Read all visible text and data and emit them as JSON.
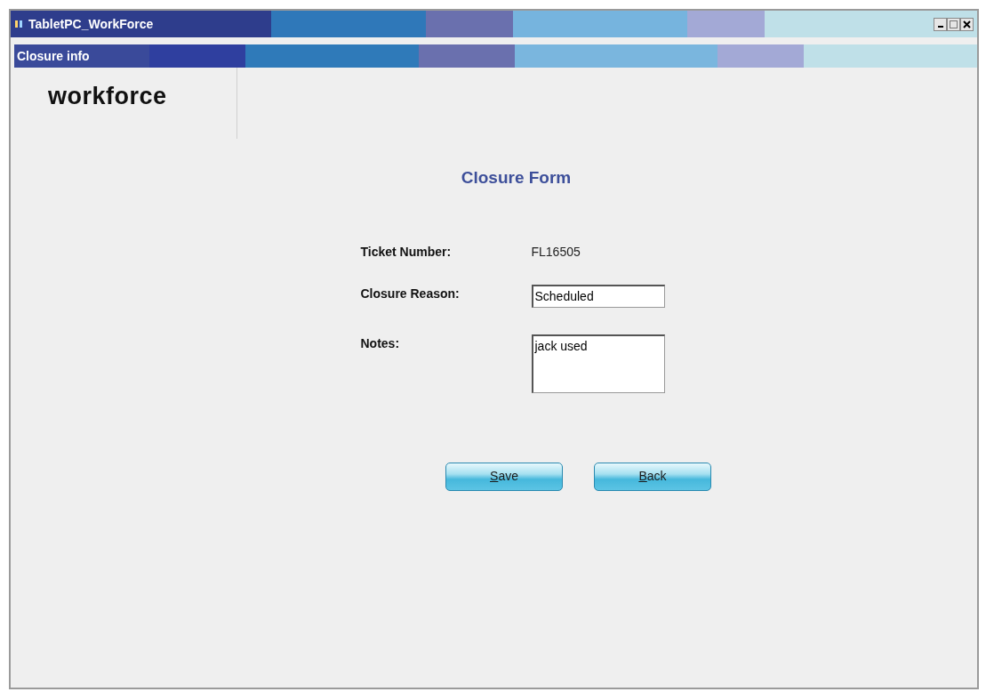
{
  "window": {
    "title": "TabletPC_WorkForce"
  },
  "subtitle_bar": {
    "title": "Closure info"
  },
  "logo": {
    "text": "workforce"
  },
  "form": {
    "title": "Closure Form",
    "fields": [
      {
        "kind": "static",
        "label": "Ticket Number:",
        "value": "FL16505"
      },
      {
        "kind": "text",
        "label": "Closure Reason:",
        "value": "Scheduled"
      },
      {
        "kind": "multiline",
        "label": "Notes:",
        "value": "jack used"
      }
    ]
  },
  "buttons": [
    {
      "label": "Save",
      "mnemonic": true
    },
    {
      "label": "Back",
      "mnemonic": true
    }
  ]
}
